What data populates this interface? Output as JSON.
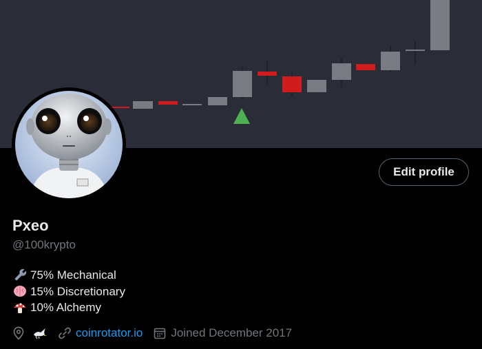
{
  "profile": {
    "display_name": "Pxeo",
    "handle": "@100krypto",
    "edit_button_label": "Edit profile",
    "bio": [
      {
        "emoji": "wrench-icon",
        "text": "75% Mechanical"
      },
      {
        "emoji": "brain-icon",
        "text": "15% Discretionary"
      },
      {
        "emoji": "mushroom-icon",
        "text": "10% Alchemy"
      }
    ],
    "location_icon": "dove-icon",
    "website": "coinrotator.io",
    "joined": "Joined December 2017"
  },
  "banner": {
    "description_icons": [
      "candlestick-chart",
      "up-triangle-icon"
    ],
    "colors": {
      "background": "#2a2d37",
      "candle_up": "#7a7c84",
      "candle_down": "#d01c1c",
      "triangle": "#4caf50"
    }
  },
  "theme": {
    "background": "#000000",
    "text_primary": "#e7e9ea",
    "text_secondary": "#71767b",
    "link": "#1d9bf0",
    "border": "#536471"
  }
}
